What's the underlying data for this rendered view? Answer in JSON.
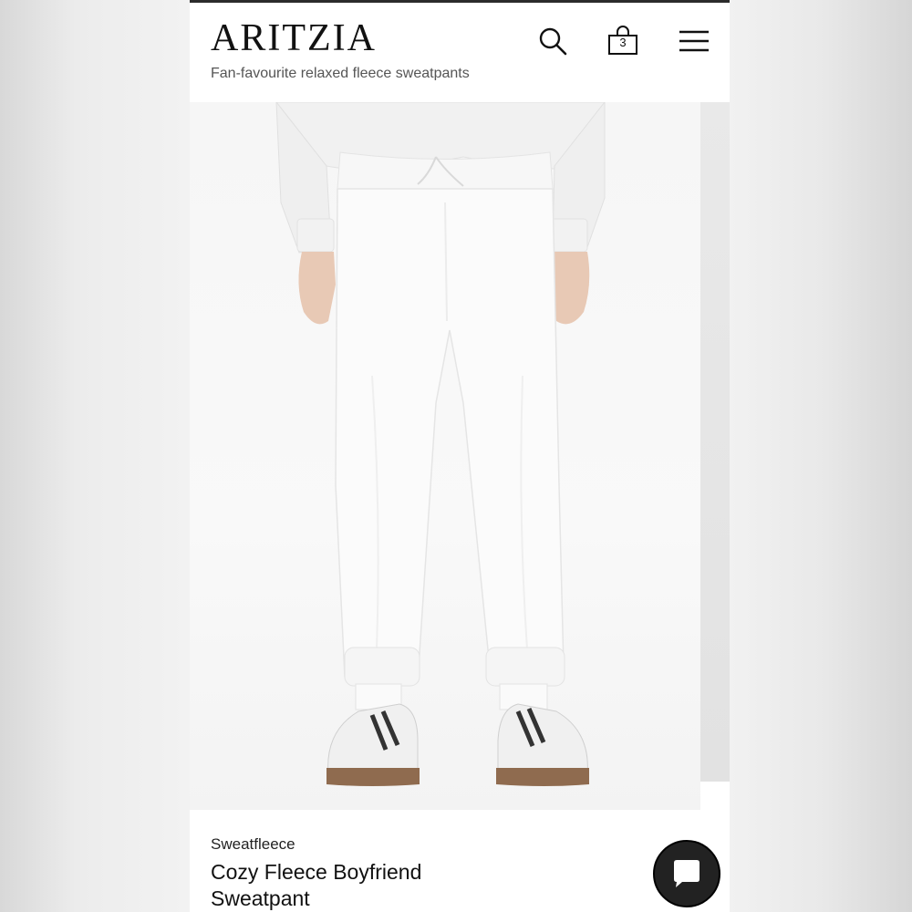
{
  "header": {
    "logo": "ARITZIA",
    "search_icon": "search-icon",
    "bag_icon": "shopping-bag-icon",
    "bag_count": "3",
    "menu_icon": "hamburger-menu-icon"
  },
  "subtitle_cut": "Fan-favourite relaxed fleece sweatpants",
  "product_image": {
    "type": "product-photo"
  },
  "product": {
    "category": "Sweatfleece",
    "name": "Cozy Fleece Boyfriend Sweatpant"
  },
  "chat": {
    "icon": "chat-bubble-icon"
  },
  "colors": {
    "background": "#ffffff",
    "text": "#111111",
    "chat_button": "#222222"
  }
}
